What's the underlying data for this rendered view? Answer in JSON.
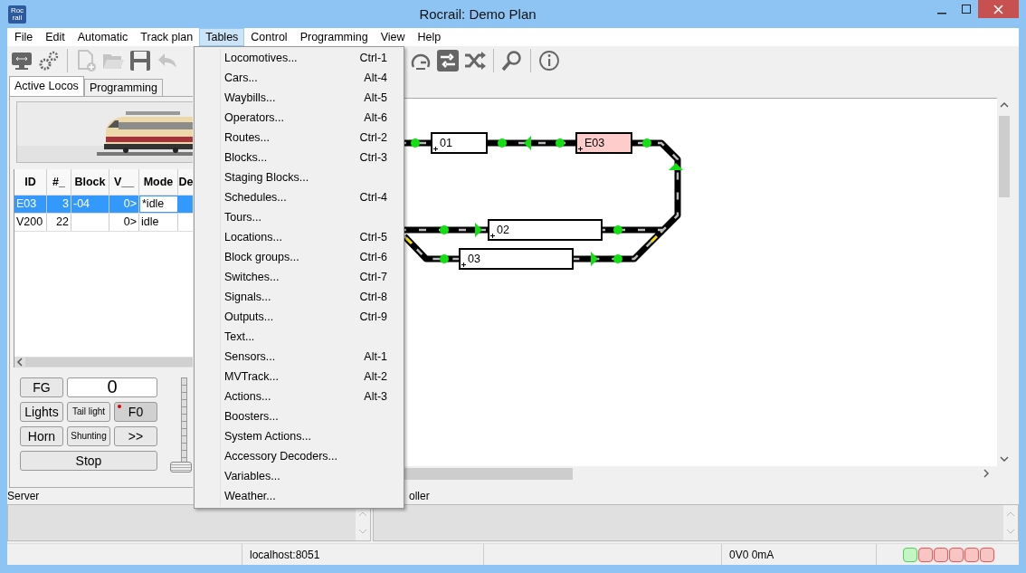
{
  "window": {
    "title": "Rocrail: Demo Plan",
    "app_icon": [
      "Roc",
      "rail"
    ]
  },
  "menu_bar": [
    {
      "label": "File",
      "selected": false
    },
    {
      "label": "Edit",
      "selected": false
    },
    {
      "label": "Automatic",
      "selected": false
    },
    {
      "label": "Track plan",
      "selected": false
    },
    {
      "label": "Tables",
      "selected": true
    },
    {
      "label": "Control",
      "selected": false
    },
    {
      "label": "Programming",
      "selected": false
    },
    {
      "label": "View",
      "selected": false
    },
    {
      "label": "Help",
      "selected": false
    }
  ],
  "toolbar": [
    {
      "kind": "monitor",
      "disabled": false
    },
    {
      "kind": "gears",
      "disabled": false
    },
    {
      "kind": "new",
      "disabled": true
    },
    {
      "kind": "open",
      "disabled": true
    },
    {
      "kind": "save",
      "disabled": false
    },
    {
      "kind": "undo",
      "disabled": true
    },
    {
      "kind": "speedometer",
      "disabled": false
    },
    {
      "kind": "routes",
      "disabled": false
    },
    {
      "kind": "shuffle",
      "disabled": false
    },
    {
      "kind": "search",
      "disabled": false
    },
    {
      "kind": "info",
      "disabled": false
    }
  ],
  "tabs": [
    {
      "label": "Active Locos",
      "selected": true
    },
    {
      "label": "Programming",
      "selected": false
    }
  ],
  "loco_table": {
    "columns": [
      "ID",
      "#_",
      "Block",
      "V__",
      "Mode",
      "De"
    ],
    "rows": [
      {
        "cells": [
          "E03",
          "3",
          "-04",
          "0>",
          "*idle"
        ],
        "selected": true
      },
      {
        "cells": [
          "V200",
          "22",
          "",
          "0>",
          "idle"
        ],
        "selected": false
      }
    ]
  },
  "throttle": {
    "display": "0",
    "buttons": [
      {
        "label": "FG",
        "kind": "normal",
        "on": false
      },
      {
        "label": "Lights",
        "kind": "normal",
        "on": false
      },
      {
        "label": "Tail light",
        "kind": "small",
        "on": false
      },
      {
        "label": "F0",
        "kind": "normal",
        "on": true
      },
      {
        "label": "Horn",
        "kind": "normal",
        "on": false
      },
      {
        "label": "Shunting",
        "kind": "small",
        "on": false
      },
      {
        "label": ">>",
        "kind": "normal",
        "on": false
      },
      {
        "label": "Stop",
        "kind": "wide",
        "on": false
      }
    ],
    "speed": {
      "level": 0
    }
  },
  "plan": {
    "blocks": [
      {
        "label": "01",
        "occupied": false
      },
      {
        "label": "E03",
        "occupied": true
      },
      {
        "label": "02",
        "occupied": false
      },
      {
        "label": "03",
        "occupied": false
      }
    ]
  },
  "tables_menu": [
    {
      "label": "Locomotives...",
      "shortcut": "Ctrl-1"
    },
    {
      "label": "Cars...",
      "shortcut": "Alt-4"
    },
    {
      "label": "Waybills...",
      "shortcut": "Alt-5"
    },
    {
      "label": "Operators...",
      "shortcut": "Alt-6"
    },
    {
      "label": "Routes...",
      "shortcut": "Ctrl-2"
    },
    {
      "label": "Blocks...",
      "shortcut": "Ctrl-3"
    },
    {
      "label": "Staging Blocks..."
    },
    {
      "label": "Schedules...",
      "shortcut": "Ctrl-4"
    },
    {
      "label": "Tours..."
    },
    {
      "label": "Locations...",
      "shortcut": "Ctrl-5"
    },
    {
      "label": "Block groups...",
      "shortcut": "Ctrl-6"
    },
    {
      "label": "Switches...",
      "shortcut": "Ctrl-7"
    },
    {
      "label": "Signals...",
      "shortcut": "Ctrl-8"
    },
    {
      "label": "Outputs...",
      "shortcut": "Ctrl-9"
    },
    {
      "label": "Text..."
    },
    {
      "label": "Sensors...",
      "shortcut": "Alt-1"
    },
    {
      "label": "MVTrack...",
      "shortcut": "Alt-2"
    },
    {
      "label": "Actions...",
      "shortcut": "Alt-3"
    },
    {
      "label": "Boosters..."
    },
    {
      "label": "System Actions..."
    },
    {
      "label": "Accessory Decoders..."
    },
    {
      "label": "Variables..."
    },
    {
      "label": "Weather..."
    }
  ],
  "server_panel": {
    "label": "Server"
  },
  "controller_panel": {
    "label": "oller"
  },
  "status_bar": {
    "host": "localhost:8051",
    "power": "0V0 0mA",
    "indicators": [
      {
        "color": "#c4f5c4"
      },
      {
        "color": "#f8c4c4"
      },
      {
        "color": "#f8c4c4"
      },
      {
        "color": "#f8c4c4"
      },
      {
        "color": "#f8c4c4"
      },
      {
        "color": "#f8c4c4"
      }
    ]
  }
}
